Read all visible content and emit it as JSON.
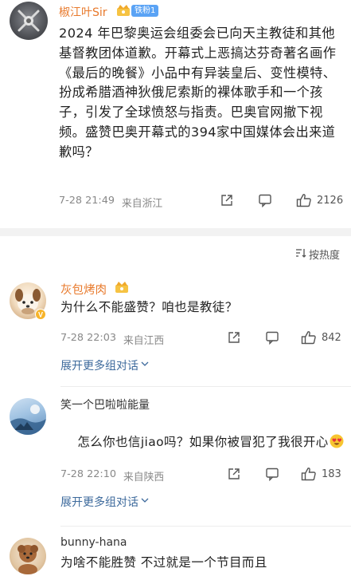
{
  "post": {
    "username": "椒江叶Sir",
    "fan_badge": "铁粉1",
    "text": "2024 年巴黎奥运会组委会已向天主教徒和其他基督教团体道歉。开幕式上恶搞达芬奇著名画作《最后的晚餐》小品中有异装皇后、变性模特、扮成希腊酒神狄俄尼索斯的裸体歌手和一个孩子，引发了全球愤怒与指责。巴奥官网撤下视频。盛赞巴奥开幕式的394家中国媒体会出来道歉吗？",
    "timestamp": "7-28 21:49",
    "location": "来自浙江",
    "likes": "2126"
  },
  "sort": {
    "label": "按热度"
  },
  "comments": [
    {
      "username": "灰包烤肉",
      "text": "为什么不能盛赞？咱也是教徒？",
      "timestamp": "7-28 22:03",
      "location": "来自江西",
      "likes": "842",
      "expand": "展开更多组对话"
    },
    {
      "username": "笑一个巴啦啦能量",
      "text": "怎么你也信jiao吗？如果你被冒犯了我很开心",
      "timestamp": "7-28 22:10",
      "location": "来自陕西",
      "likes": "183",
      "expand": "展开更多组对话"
    },
    {
      "username": "bunny-hana",
      "text": "为啥不能胜赞 不过就是一个节目而且"
    }
  ],
  "colors": {
    "username_orange": "#e8792b",
    "fan_badge_blue": "#5aa3f5",
    "link_blue": "#3d6a9c"
  },
  "icons": [
    "share-icon",
    "comment-icon",
    "like-icon",
    "sort-icon",
    "chevron-down-icon",
    "vip-crown-icon",
    "verified-badge-icon",
    "heart-eyes-emoji"
  ]
}
